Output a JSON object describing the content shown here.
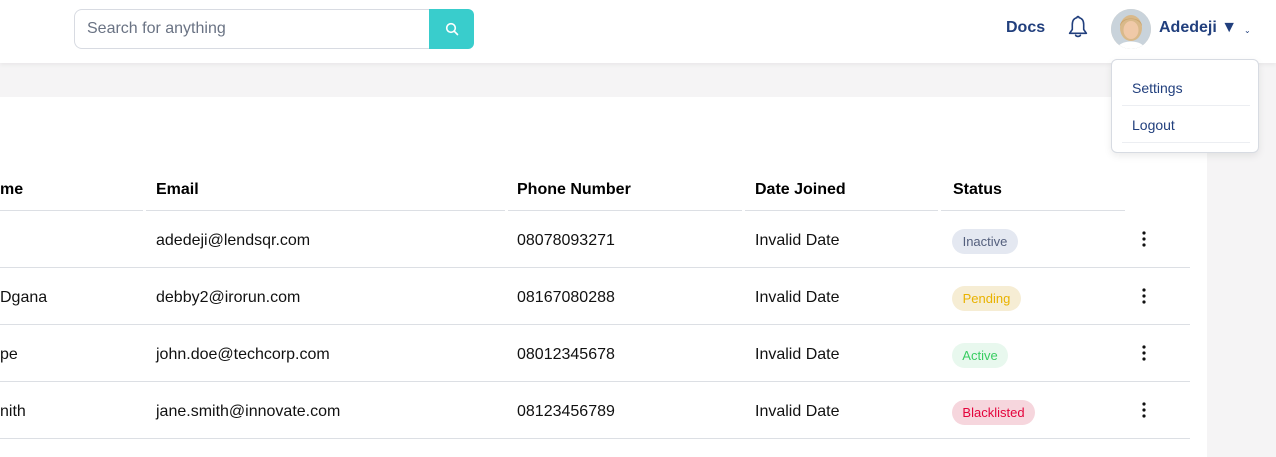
{
  "header": {
    "search": {
      "placeholder": "Search for anything",
      "value": ""
    },
    "search_icon": "search-icon",
    "docs_label": "Docs",
    "bell_icon": "bell-icon",
    "user_name": "Adedeji ▼",
    "caret": "⌄",
    "accent_color": "#39cdcc",
    "brand_color": "#213f7d"
  },
  "dropdown": {
    "items": [
      {
        "label": "Settings"
      },
      {
        "label": "Logout"
      }
    ]
  },
  "table": {
    "columns": [
      "me",
      "Email",
      "Phone Number",
      "Date Joined",
      "Status"
    ],
    "rows": [
      {
        "name": "",
        "email": "adedeji@lendsqr.com",
        "phone": "08078093271",
        "date": "Invalid Date",
        "status": "Inactive"
      },
      {
        "name": "Dgana",
        "email": "debby2@irorun.com",
        "phone": "08167080288",
        "date": "Invalid Date",
        "status": "Pending"
      },
      {
        "name": "pe",
        "email": "john.doe@techcorp.com",
        "phone": "08012345678",
        "date": "Invalid Date",
        "status": "Active"
      },
      {
        "name": "nith",
        "email": "jane.smith@innovate.com",
        "phone": "08123456789",
        "date": "Invalid Date",
        "status": "Blacklisted"
      }
    ],
    "status_colors": {
      "Inactive": {
        "bg": "#e4e8f1",
        "fg": "#545f7d"
      },
      "Pending": {
        "bg": "#f6edd4",
        "fg": "#e9b200"
      },
      "Active": {
        "bg": "#e8f8ee",
        "fg": "#39cd62"
      },
      "Blacklisted": {
        "bg": "#f6d6dd",
        "fg": "#e4033b"
      }
    }
  }
}
